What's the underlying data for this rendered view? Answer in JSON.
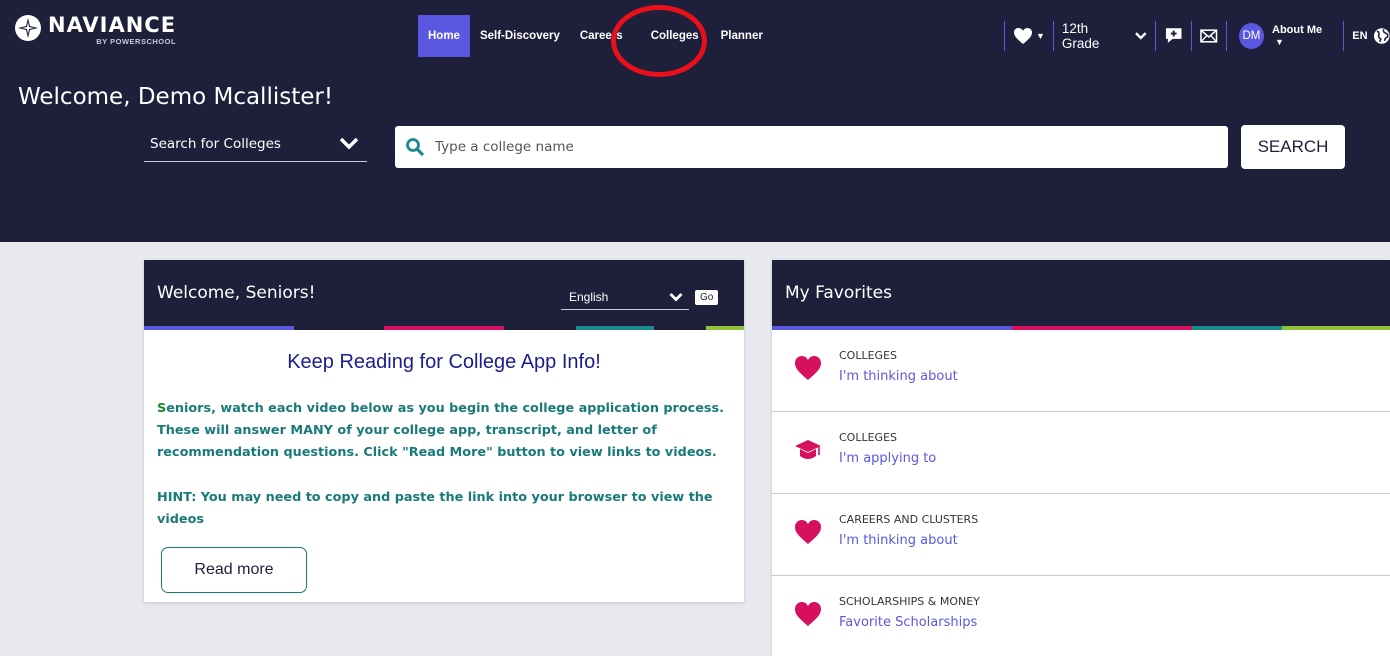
{
  "header": {
    "logo_brand": "NAVIANCE",
    "logo_sub": "BY POWERSCHOOL",
    "nav": [
      {
        "label": "Home",
        "active": true
      },
      {
        "label": "Self-Discovery"
      },
      {
        "label": "Careers"
      },
      {
        "label": "Colleges"
      },
      {
        "label": "Planner"
      }
    ],
    "grade": "12th Grade",
    "avatar_initials": "DM",
    "about_me": "About Me",
    "language": "EN",
    "welcome": "Welcome, Demo Mcallister!"
  },
  "search": {
    "type_label": "Search for Colleges",
    "placeholder": "Type a college name",
    "button": "SEARCH"
  },
  "welcome_card": {
    "title": "Welcome, Seniors!",
    "language_option": "English",
    "go_label": "Go",
    "heading": "Keep Reading for College App Info!",
    "first_letter": "S",
    "paragraph": "eniors, watch each video below as you begin the college application process. These will answer MANY of your college app, transcript, and letter of recommendation questions. Click \"Read More\" button to view links to videos.",
    "hint": "HINT: You may need to copy and paste the link into your browser to view the videos",
    "read_more": "Read more"
  },
  "favorites_card": {
    "title": "My Favorites",
    "items": [
      {
        "category": "COLLEGES",
        "link": "I'm thinking about",
        "icon": "heart-icon"
      },
      {
        "category": "COLLEGES",
        "link": "I'm applying to",
        "icon": "graduation-cap-icon"
      },
      {
        "category": "CAREERS AND CLUSTERS",
        "link": "I'm thinking about",
        "icon": "heart-icon"
      },
      {
        "category": "SCHOLARSHIPS & MONEY",
        "link": "Favorite Scholarships",
        "icon": "heart-icon"
      }
    ]
  },
  "colors": {
    "header_bg": "#1e1f3b",
    "accent": "#5a57e0",
    "heart": "#d6105f",
    "annotation": "#e8101b",
    "stripe": [
      "#5a57e0",
      "#1e1f3b",
      "#d6105f",
      "#1e1f3b",
      "#1a8a8a",
      "#1e1f3b",
      "#8fc23a"
    ]
  }
}
